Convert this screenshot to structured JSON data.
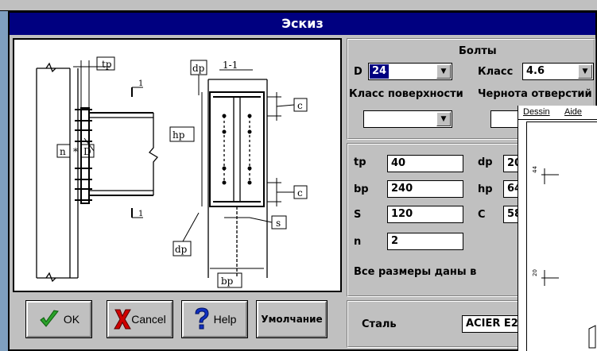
{
  "dialog": {
    "title": "Эскиз"
  },
  "sketch": {
    "labels": {
      "tp": "tp",
      "dp_top": "dp",
      "section": "1-1",
      "one_top": "1",
      "one_bottom": "1",
      "hp": "hp",
      "c_top": "c",
      "c_bottom": "c",
      "n": "n",
      "star": "*",
      "D": "D",
      "s": "s",
      "dp_bottom": "dp",
      "bp": "bp"
    }
  },
  "bolts": {
    "group_title": "Болты",
    "d_label": "D",
    "d_value": "24",
    "class_label": "Класс",
    "class_value": "4.6",
    "surface_label": "Класс поверхности",
    "roughness_label": "Чернота отверстий",
    "surface_value": "",
    "roughness_value": ""
  },
  "dimensions": {
    "tp_label": "tp",
    "tp_value": "40",
    "bp_label": "bp",
    "bp_value": "240",
    "s_label": "S",
    "s_value": "120",
    "n_label": "n",
    "n_value": "2",
    "dp_label": "dp",
    "dp_value": "20",
    "hp_label": "hp",
    "hp_value": "64",
    "c_label": "C",
    "c_value": "58",
    "units_text": "Все размеры даны в"
  },
  "steel": {
    "label": "Сталь",
    "value": "ACIER E2"
  },
  "buttons": {
    "ok": "OK",
    "cancel": "Cancel",
    "help": "Help",
    "default": "Умолчание"
  },
  "dessin_window": {
    "menu_file": "Dessin",
    "menu_help": "Aide",
    "dim_top": "44",
    "dim_bottom": "20"
  },
  "colors": {
    "titlebar": "#000080",
    "dialog_bg": "#c0c0c0",
    "ok_check": "#2aa02a",
    "cancel_x": "#d00000",
    "help_q": "#1030c0"
  }
}
